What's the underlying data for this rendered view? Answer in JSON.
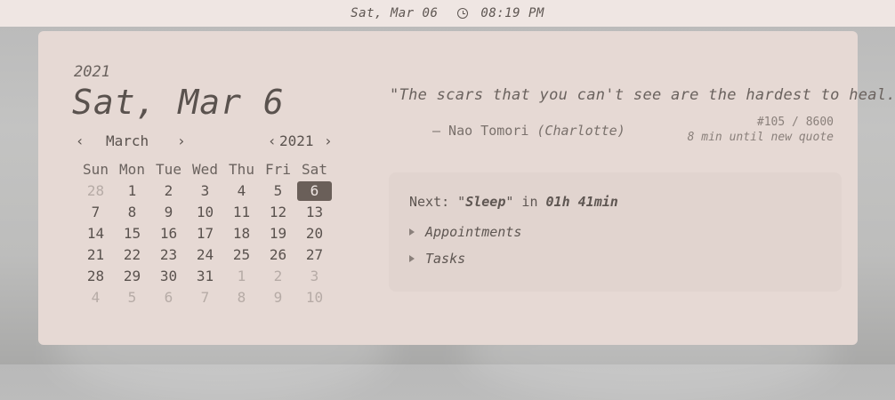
{
  "topbar": {
    "date": "Sat, Mar 06",
    "time": "08:19 PM"
  },
  "date_panel": {
    "year": "2021",
    "full_date": "Sat, Mar 6"
  },
  "calendar": {
    "month": "March",
    "year": "2021",
    "prev_month": "‹",
    "next_month": "›",
    "prev_year": "‹",
    "next_year": "›",
    "weekdays": [
      "Sun",
      "Mon",
      "Tue",
      "Wed",
      "Thu",
      "Fri",
      "Sat"
    ],
    "weeks": [
      [
        "28",
        "1",
        "2",
        "3",
        "4",
        "5",
        "6"
      ],
      [
        "7",
        "8",
        "9",
        "10",
        "11",
        "12",
        "13"
      ],
      [
        "14",
        "15",
        "16",
        "17",
        "18",
        "19",
        "20"
      ],
      [
        "21",
        "22",
        "23",
        "24",
        "25",
        "26",
        "27"
      ],
      [
        "28",
        "29",
        "30",
        "31",
        "1",
        "2",
        "3"
      ],
      [
        "4",
        "5",
        "6",
        "7",
        "8",
        "9",
        "10"
      ]
    ]
  },
  "quote": {
    "text": "\"The scars that you can't see are the hardest to heal.\"",
    "author": "— Nao Tomori",
    "source": "(Charlotte)",
    "counter": "#105 / 8600",
    "refresh": "8 min until new quote"
  },
  "events": {
    "next_prefix": "Next: \"",
    "next_event": "Sleep",
    "next_mid": "\" in ",
    "next_time": "01h 41min",
    "sections": [
      "Appointments",
      "Tasks"
    ]
  }
}
